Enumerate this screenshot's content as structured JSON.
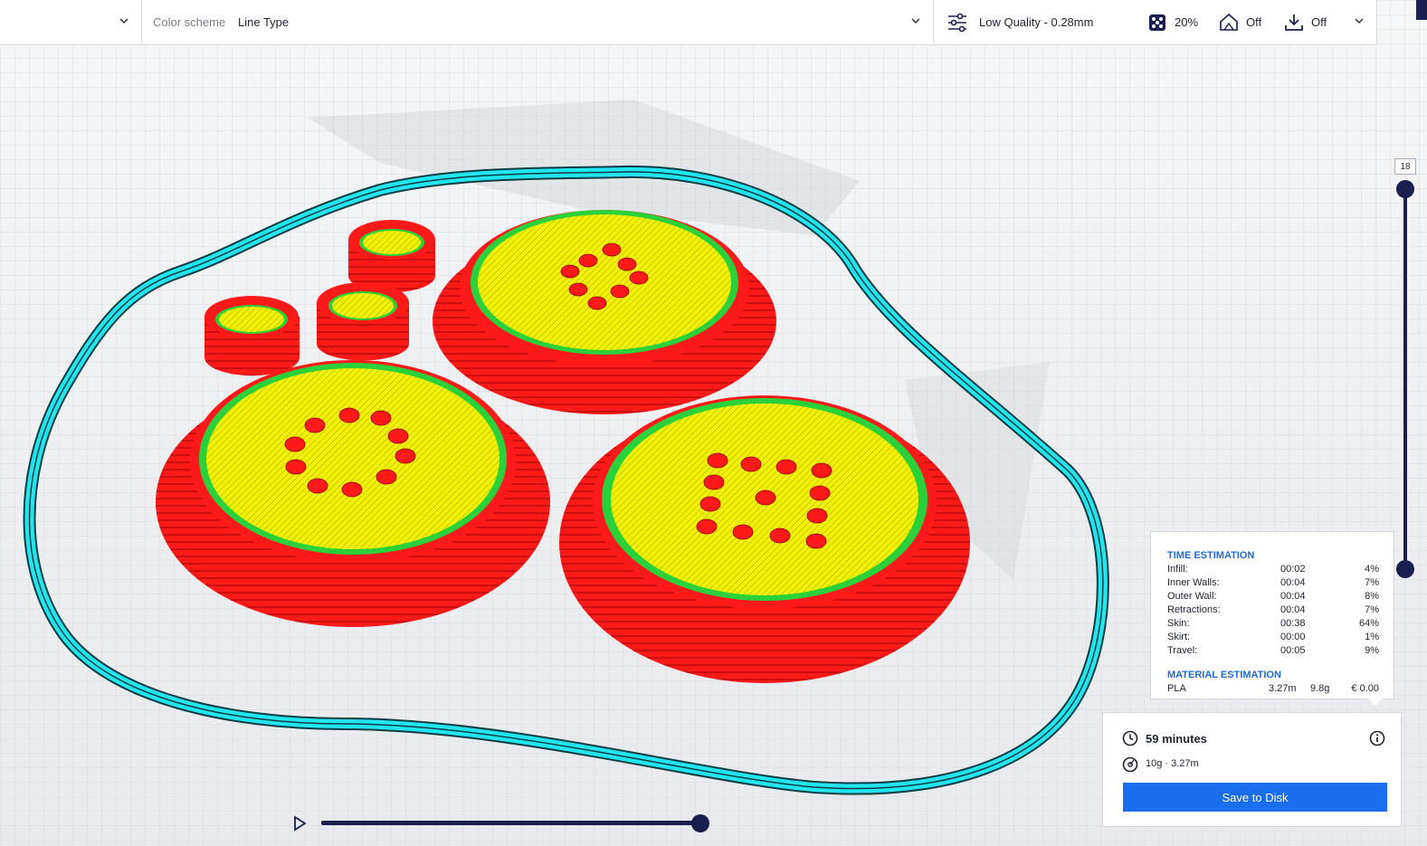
{
  "toolbar": {
    "color_scheme_label": "Color scheme",
    "color_scheme_value": "Line Type",
    "profile": "Low Quality - 0.28mm",
    "infill": "20%",
    "support": "Off",
    "adhesion": "Off"
  },
  "layer_slider": {
    "value": "18"
  },
  "estimation": {
    "time_title": "TIME ESTIMATION",
    "rows": [
      {
        "label": "Infill:",
        "time": "00:02",
        "pct": "4%"
      },
      {
        "label": "Inner Walls:",
        "time": "00:04",
        "pct": "7%"
      },
      {
        "label": "Outer Wall:",
        "time": "00:04",
        "pct": "8%"
      },
      {
        "label": "Retractions:",
        "time": "00:04",
        "pct": "7%"
      },
      {
        "label": "Skin:",
        "time": "00:38",
        "pct": "64%"
      },
      {
        "label": "Skirt:",
        "time": "00:00",
        "pct": "1%"
      },
      {
        "label": "Travel:",
        "time": "00:05",
        "pct": "9%"
      }
    ],
    "material_title": "MATERIAL ESTIMATION",
    "material": {
      "name": "PLA",
      "length": "3.27m",
      "weight": "9.8g",
      "cost": "€ 0.00"
    }
  },
  "print_info": {
    "duration": "59 minutes",
    "material": "10g · 3.27m",
    "save_label": "Save to Disk"
  },
  "colors": {
    "accent": "#196ef0",
    "slider": "#1a1f4f",
    "skin": "#f5f500",
    "wall": "#ff1a1a",
    "inner_wall": "#2bd13a",
    "skirt": "#22e6ef"
  }
}
